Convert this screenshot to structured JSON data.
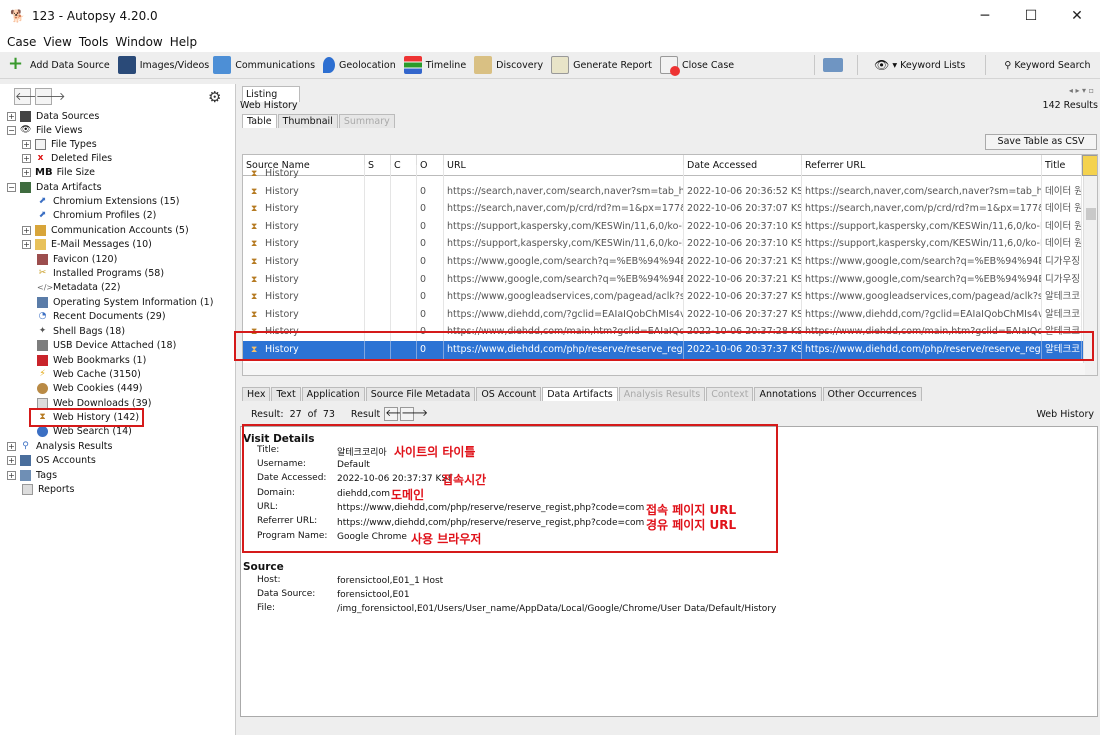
{
  "window": {
    "title": "123 - Autopsy 4.20.0",
    "minimize": "─",
    "maximize": "☐",
    "close": "✕"
  },
  "menu": [
    "Case",
    "View",
    "Tools",
    "Window",
    "Help"
  ],
  "toolbar": {
    "add_data_source": "Add Data Source",
    "images_videos": "Images/Videos",
    "communications": "Communications",
    "geolocation": "Geolocation",
    "timeline": "Timeline",
    "discovery": "Discovery",
    "generate_report": "Generate Report",
    "close_case": "Close Case",
    "keyword_lists": "▾ Keyword Lists",
    "keyword_search": "Keyword Search"
  },
  "tree": {
    "data_sources": "Data Sources",
    "file_views": "File Views",
    "file_types": "File Types",
    "deleted_files": "Deleted Files",
    "mb_label": "MB",
    "file_size": "File Size",
    "data_artifacts": "Data Artifacts",
    "items": [
      "Chromium Extensions (15)",
      "Chromium Profiles (2)",
      "Communication Accounts (5)",
      "E-Mail Messages (10)",
      "Favicon (120)",
      "Installed Programs (58)",
      "Metadata (22)",
      "Operating System Information (1)",
      "Recent Documents (29)",
      "Shell Bags (18)",
      "USB Device Attached (18)",
      "Web Bookmarks (1)",
      "Web Cache (3150)",
      "Web Cookies (449)",
      "Web Downloads (39)",
      "Web History (142)",
      "Web Search (14)"
    ],
    "analysis_results": "Analysis Results",
    "os_accounts": "OS Accounts",
    "tags": "Tags",
    "reports": "Reports"
  },
  "listing": {
    "tab": "Listing",
    "section": "Web History",
    "count": "142  Results",
    "subtabs": [
      "Table",
      "Thumbnail",
      "Summary"
    ],
    "save_csv": "Save Table as CSV",
    "columns": [
      "Source Name",
      "S",
      "C",
      "O",
      "URL",
      "Date Accessed",
      "Referrer URL",
      "Title"
    ],
    "rows": [
      {
        "name": "History",
        "o": "",
        "url": "",
        "date": "",
        "ref": "",
        "title": ""
      },
      {
        "name": "History",
        "o": "0",
        "url": "https://search,naver,com/search,naver?sm=tab_ht,...",
        "date": "2022-10-06 20:36:52 KST",
        "ref": "https://search,naver,com/search,naver?sm=tab_ht,...",
        "title": "데이터 원"
      },
      {
        "name": "History",
        "o": "0",
        "url": "https://search,naver,com/p/crd/rd?m=1&px=177&py,...",
        "date": "2022-10-06 20:37:07 KST",
        "ref": "https://search,naver,com/p/crd/rd?m=1&px=177&py,...",
        "title": "데이터 원"
      },
      {
        "name": "History",
        "o": "0",
        "url": "https://support,kaspersky,com/KESWin/11,6,0/ko-K,...",
        "date": "2022-10-06 20:37:10 KST",
        "ref": "https://support,kaspersky,com/KESWin/11,6,0/ko-K,...",
        "title": "데이터 원"
      },
      {
        "name": "History",
        "o": "0",
        "url": "https://support,kaspersky,com/KESWin/11,6,0/ko-K,...",
        "date": "2022-10-06 20:37:10 KST",
        "ref": "https://support,kaspersky,com/KESWin/11,6,0/ko-K,...",
        "title": "데이터 원"
      },
      {
        "name": "History",
        "o": "0",
        "url": "https://www,google,com/search?q=%EB%94%94E,...",
        "date": "2022-10-06 20:37:21 KST",
        "ref": "https://www,google,com/search?q=%EB%94%94E,...",
        "title": "디가우징"
      },
      {
        "name": "History",
        "o": "0",
        "url": "https://www,google,com/search?q=%EB%94%94E,...",
        "date": "2022-10-06 20:37:21 KST",
        "ref": "https://www,google,com/search?q=%EB%94%94E,...",
        "title": "디가우징"
      },
      {
        "name": "History",
        "o": "0",
        "url": "https://www,googleadservices,com/pagead/aclk?s,...",
        "date": "2022-10-06 20:37:27 KST",
        "ref": "https://www,googleadservices,com/pagead/aclk?s,...",
        "title": "알테크코리"
      },
      {
        "name": "History",
        "o": "0",
        "url": "https://www,diehdd,com/?gclid=EAIaIQobChMIs4vA,...",
        "date": "2022-10-06 20:37:27 KST",
        "ref": "https://www,diehdd,com/?gclid=EAIaIQobChMIs4vA,...",
        "title": "알테크코리"
      },
      {
        "name": "History",
        "o": "0",
        "url": "https://www,diehdd,com/main,htm?gclid=EAIaIQob,...",
        "date": "2022-10-06 20:37:28 KST",
        "ref": "https://www,diehdd,com/main,htm?gclid=EAIaIQob,...",
        "title": "알테크코리"
      },
      {
        "name": "History",
        "o": "0",
        "url": "https://www,diehdd,com/php/reserve/reserve_regi,...",
        "date": "2022-10-06 20:37:37 KST",
        "ref": "https://www,diehdd,com/php/reserve/reserve_regi,...",
        "title": "알테크코리"
      }
    ]
  },
  "lower_tabs": [
    "Hex",
    "Text",
    "Application",
    "Source File Metadata",
    "OS Account",
    "Data Artifacts",
    "Analysis Results",
    "Context",
    "Annotations",
    "Other Occurrences"
  ],
  "result_bar": {
    "result": "Result:",
    "num": "27",
    "of": "of",
    "total": "73",
    "result2": "Result",
    "type": "Web History"
  },
  "details": {
    "visit_header": "Visit Details",
    "title_label": "Title:",
    "title_value": "알테크코리아",
    "username_label": "Username:",
    "username_value": "Default",
    "date_label": "Date Accessed:",
    "date_value": "2022-10-06 20:37:37 KST",
    "domain_label": "Domain:",
    "domain_value": "diehdd,com",
    "url_label": "URL:",
    "url_value": "https://www,diehdd,com/php/reserve/reserve_regist,php?code=com",
    "ref_label": "Referrer URL:",
    "ref_value": "https://www,diehdd,com/php/reserve/reserve_regist,php?code=com",
    "prog_label": "Program Name:",
    "prog_value": "Google Chrome",
    "source_header": "Source",
    "host_label": "Host:",
    "host_value": "forensictool,E01_1 Host",
    "ds_label": "Data Source:",
    "ds_value": "forensictool,E01",
    "file_label": "File:",
    "file_value": "/img_forensictool,E01/Users/User_name/AppData/Local/Google/Chrome/User Data/Default/History"
  },
  "annotations": {
    "title": "사이트의 타이틀",
    "date": "접속시간",
    "domain": "도메인",
    "url": "접속 페이지 URL",
    "ref": "경유 페이지 URL",
    "prog": "사용 브라우저"
  }
}
